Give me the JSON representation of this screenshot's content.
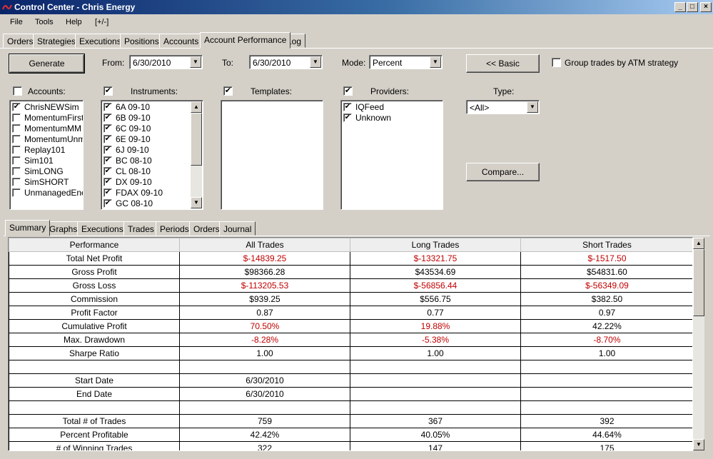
{
  "window": {
    "title": "Control Center - Chris Energy"
  },
  "menu": [
    "File",
    "Tools",
    "Help",
    "[+/-]"
  ],
  "main_tabs": [
    {
      "label": "Orders"
    },
    {
      "label": "Strategies"
    },
    {
      "label": "Executions"
    },
    {
      "label": "Positions"
    },
    {
      "label": "Accounts"
    },
    {
      "label": "Account Performance"
    },
    {
      "label": "Log"
    }
  ],
  "toolbar": {
    "generate_label": "Generate",
    "from_label": "From:",
    "from_value": "6/30/2010",
    "to_label": "To:",
    "to_value": "6/30/2010",
    "mode_label": "Mode:",
    "mode_value": "Percent",
    "basic_label": "<< Basic",
    "group_label": "Group trades by ATM strategy",
    "compare_label": "Compare...",
    "type_label": "Type:",
    "type_value": "<All>"
  },
  "accounts": {
    "label": "Accounts:",
    "items": [
      {
        "name": "ChrisNEWSim",
        "checked": "✔"
      },
      {
        "name": "MomentumFirst",
        "checked": ""
      },
      {
        "name": "MomentumMM",
        "checked": ""
      },
      {
        "name": "MomentumUnmar",
        "checked": ""
      },
      {
        "name": "Replay101",
        "checked": ""
      },
      {
        "name": "Sim101",
        "checked": ""
      },
      {
        "name": "SimLONG",
        "checked": ""
      },
      {
        "name": "SimSHORT",
        "checked": ""
      },
      {
        "name": "UnmanagedEnerç",
        "checked": ""
      }
    ]
  },
  "instruments": {
    "label": "Instruments:",
    "items": [
      {
        "name": "6A 09-10",
        "checked": "✔"
      },
      {
        "name": "6B 09-10",
        "checked": "✔"
      },
      {
        "name": "6C 09-10",
        "checked": "✔"
      },
      {
        "name": "6E 09-10",
        "checked": "✔"
      },
      {
        "name": "6J 09-10",
        "checked": "✔"
      },
      {
        "name": "BC 08-10",
        "checked": "✔"
      },
      {
        "name": "CL 08-10",
        "checked": "✔"
      },
      {
        "name": "DX 09-10",
        "checked": "✔"
      },
      {
        "name": "FDAX 09-10",
        "checked": "✔"
      },
      {
        "name": "GC 08-10",
        "checked": "✔"
      }
    ]
  },
  "templates": {
    "label": "Templates:"
  },
  "providers": {
    "label": "Providers:",
    "items": [
      {
        "name": "IQFeed",
        "checked": "✔"
      },
      {
        "name": "Unknown",
        "checked": "✔"
      }
    ]
  },
  "result_tabs": [
    {
      "label": "Summary"
    },
    {
      "label": "Graphs"
    },
    {
      "label": "Executions"
    },
    {
      "label": "Trades"
    },
    {
      "label": "Periods"
    },
    {
      "label": "Orders"
    },
    {
      "label": "Journal"
    }
  ],
  "summary": {
    "headers": [
      "Performance",
      "All Trades",
      "Long Trades",
      "Short Trades"
    ],
    "rows": [
      {
        "label": "Total Net Profit",
        "all": "$-14839.25",
        "long": "$-13321.75",
        "short": "$-1517.50"
      },
      {
        "label": "Gross Profit",
        "all": "$98366.28",
        "long": "$43534.69",
        "short": "$54831.60"
      },
      {
        "label": "Gross Loss",
        "all": "$-113205.53",
        "long": "$-56856.44",
        "short": "$-56349.09"
      },
      {
        "label": "Commission",
        "all": "$939.25",
        "long": "$556.75",
        "short": "$382.50"
      },
      {
        "label": "Profit Factor",
        "all": "0.87",
        "long": "0.77",
        "short": "0.97"
      },
      {
        "label": "Cumulative Profit",
        "all": "70.50%",
        "long": "19.88%",
        "short": "42.22%"
      },
      {
        "label": "Max. Drawdown",
        "all": "-8.28%",
        "long": "-5.38%",
        "short": "-8.70%"
      },
      {
        "label": "Sharpe Ratio",
        "all": "1.00",
        "long": "1.00",
        "short": "1.00"
      },
      {
        "label": "",
        "all": "",
        "long": "",
        "short": ""
      },
      {
        "label": "Start Date",
        "all": "6/30/2010",
        "long": "",
        "short": ""
      },
      {
        "label": "End Date",
        "all": "6/30/2010",
        "long": "",
        "short": ""
      },
      {
        "label": "",
        "all": "",
        "long": "",
        "short": ""
      },
      {
        "label": "Total # of Trades",
        "all": "759",
        "long": "367",
        "short": "392"
      },
      {
        "label": "Percent Profitable",
        "all": "42.42%",
        "long": "40.05%",
        "short": "44.64%"
      },
      {
        "label": "# of Winning Trades",
        "all": "322",
        "long": "147",
        "short": "175"
      }
    ],
    "negative_cells": {
      "0": [
        "all",
        "long",
        "short"
      ],
      "2": [
        "all",
        "long",
        "short"
      ],
      "5": [
        "all",
        "long"
      ],
      "6": [
        "all",
        "long",
        "short"
      ]
    }
  },
  "colors": {
    "negative": "#c00000",
    "titlebar": "#0a246a"
  }
}
